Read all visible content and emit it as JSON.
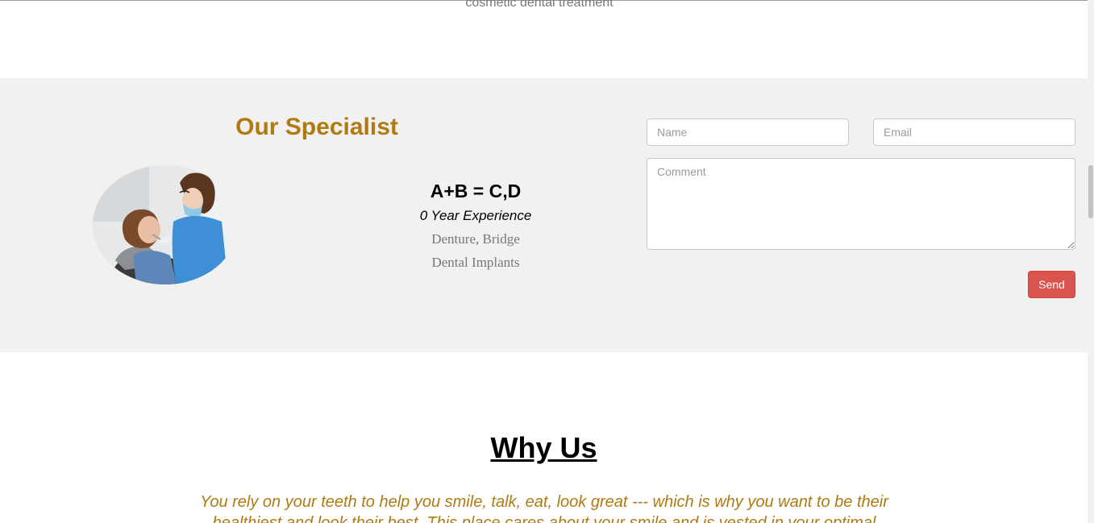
{
  "top": {
    "caption": "cosmetic dental treatment"
  },
  "specialist": {
    "title": "Our Specialist",
    "name": "A+B = C,D",
    "experience": "0 Year Experience",
    "skills": [
      "Denture, Bridge",
      "Dental Implants"
    ]
  },
  "form": {
    "name_placeholder": "Name",
    "email_placeholder": "Email",
    "comment_placeholder": "Comment",
    "send_label": "Send"
  },
  "why_us": {
    "title": "Why Us",
    "text": "You rely on your teeth to help you smile, talk, eat, look great --- which is why you want to be their healthiest and look their best. This place cares about your smile and is vested in your optimal"
  },
  "colors": {
    "accent": "#b07a12",
    "band": "#f1f1f1",
    "send": "#d9534f"
  }
}
